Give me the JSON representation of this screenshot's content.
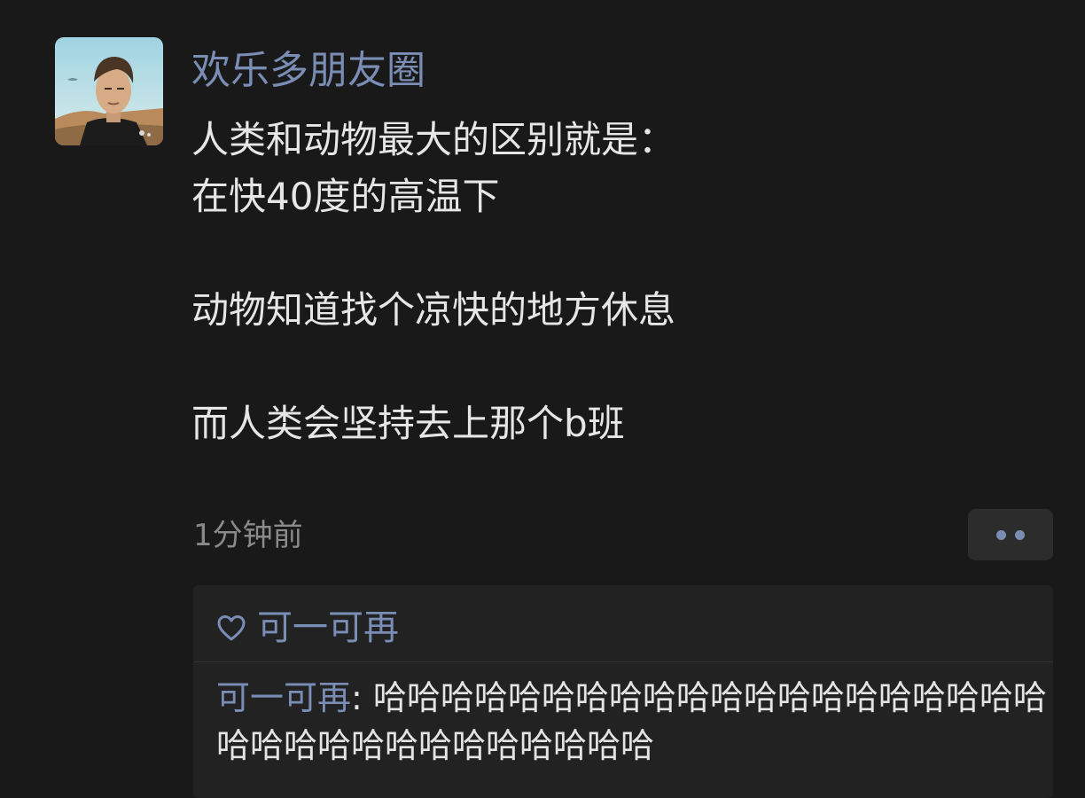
{
  "post": {
    "username": "欢乐多朋友圈",
    "lines": [
      "人类和动物最大的区别就是：",
      "在快40度的高温下",
      "",
      "动物知道找个凉快的地方休息",
      "",
      "而人类会坚持去上那个b班"
    ],
    "time": "1分钟前"
  },
  "likes": {
    "icon": "heart-icon",
    "users": [
      "可一可再"
    ]
  },
  "comments": [
    {
      "author": "可一可再",
      "separator": ": ",
      "text": "哈哈哈哈哈哈哈哈哈哈哈哈哈哈哈哈哈哈哈哈哈哈哈哈哈哈哈哈哈哈哈哈哈"
    }
  ],
  "colors": {
    "background": "#191919",
    "link_blue": "#7a8db5",
    "panel": "#222222"
  }
}
